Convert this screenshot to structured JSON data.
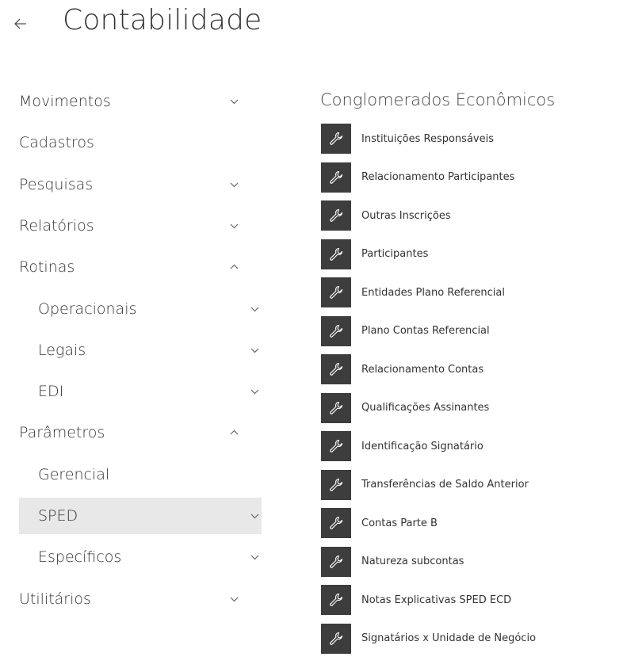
{
  "header": {
    "back_icon": "arrow-left-icon",
    "title": "Contabilidade"
  },
  "menu": {
    "items": [
      {
        "label": "Movimentos",
        "level": 0,
        "chevron": "down"
      },
      {
        "label": "Cadastros",
        "level": 0,
        "chevron": "none"
      },
      {
        "label": "Pesquisas",
        "level": 0,
        "chevron": "down"
      },
      {
        "label": "Relatórios",
        "level": 0,
        "chevron": "down"
      },
      {
        "label": "Rotinas",
        "level": 0,
        "chevron": "up"
      },
      {
        "label": "Operacionais",
        "level": 1,
        "chevron": "down"
      },
      {
        "label": "Legais",
        "level": 1,
        "chevron": "down"
      },
      {
        "label": "EDI",
        "level": 1,
        "chevron": "down"
      },
      {
        "label": "Parâmetros",
        "level": 0,
        "chevron": "up"
      },
      {
        "label": "Gerencial",
        "level": 1,
        "chevron": "none"
      },
      {
        "label": "SPED",
        "level": 1,
        "chevron": "down",
        "selected": true
      },
      {
        "label": "Específicos",
        "level": 1,
        "chevron": "down"
      },
      {
        "label": "Utilitários",
        "level": 0,
        "chevron": "down"
      }
    ]
  },
  "panel": {
    "title": "Conglomerados Econômicos",
    "icon": "wrench-icon",
    "items": [
      "Instituições Responsáveis",
      "Relacionamento Participantes",
      "Outras Inscrições",
      "Participantes",
      "Entidades Plano Referencial",
      "Plano Contas Referencial",
      "Relacionamento Contas",
      "Qualificações Assinantes",
      "Identificação Signatário",
      "Transferências de Saldo Anterior",
      "Contas Parte B",
      "Natureza subcontas",
      "Notas Explicativas SPED ECD",
      "Signatários x Unidade de Negócio"
    ]
  },
  "colors": {
    "selected_bg": "#e8e8e8",
    "icon_box": "#3d3d3d",
    "text": "#333333"
  }
}
